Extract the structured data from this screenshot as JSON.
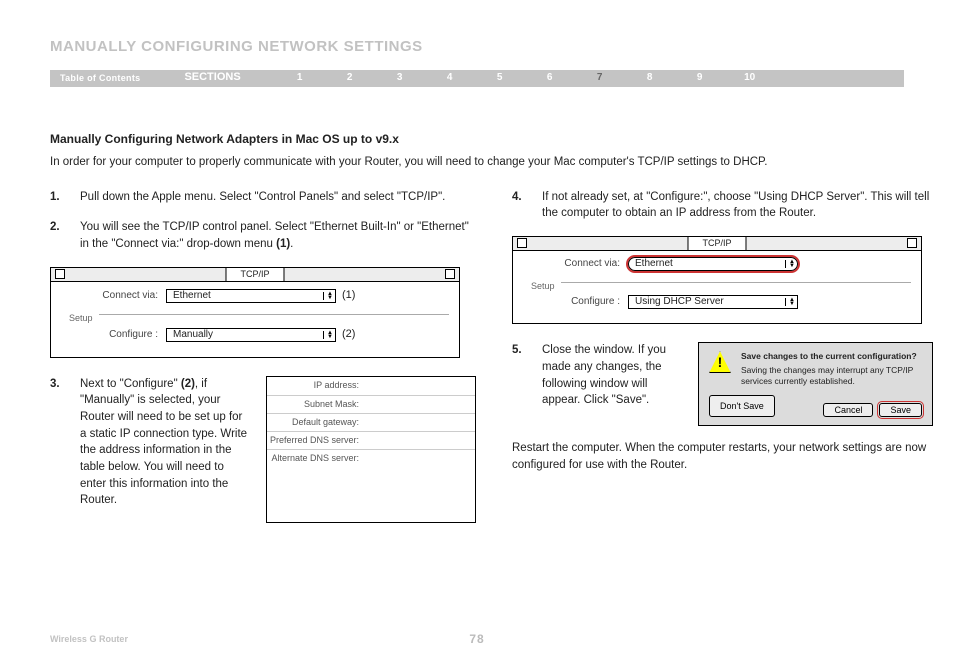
{
  "page_title": "MANUALLY CONFIGURING NETWORK SETTINGS",
  "nav": {
    "toc": "Table of Contents",
    "sections_label": "SECTIONS",
    "numbers": [
      "1",
      "2",
      "3",
      "4",
      "5",
      "6",
      "7",
      "8",
      "9",
      "10"
    ],
    "active_index": 6
  },
  "subheading": "Manually Configuring Network Adapters in Mac OS up to v9.x",
  "intro": "In order for your computer to properly communicate with your Router, you will need to change your Mac computer's TCP/IP settings to DHCP.",
  "steps": {
    "s1": {
      "n": "1.",
      "text": "Pull down the Apple menu. Select \"Control Panels\" and select \"TCP/IP\"."
    },
    "s2": {
      "n": "2.",
      "text_a": "You will see the TCP/IP control panel. Select \"Ethernet Built-In\" or \"Ethernet\" in the \"Connect via:\" drop-down menu ",
      "bold": "(1)",
      "text_b": "."
    },
    "s3": {
      "n": "3.",
      "text_a": "Next to \"Configure\" ",
      "bold": "(2)",
      "text_b": ", if \"Manually\" is selected, your Router will need to be set up for a static IP connection type. Write the address information in the table below. You will need to enter this information into the Router."
    },
    "s4": {
      "n": "4.",
      "text": "If not already set, at \"Configure:\", choose \"Using DHCP Server\". This will tell the computer to obtain an IP address from the Router."
    },
    "s5": {
      "n": "5.",
      "text": "Close the window. If you made any changes, the following window will appear. Click \"Save\"."
    }
  },
  "restart_text": "Restart the computer. When the computer restarts, your network settings are now configured for use with the Router.",
  "tcpip_window": {
    "title": "TCP/IP",
    "connect_via_label": "Connect via:",
    "connect_via_value": "Ethernet",
    "setup_label": "Setup",
    "configure_label": "Configure :",
    "configure_value_manual": "Manually",
    "configure_value_dhcp": "Using DHCP Server",
    "marker1": "(1)",
    "marker2": "(2)"
  },
  "ip_table": {
    "rows": [
      {
        "k": "IP address:",
        "v": ""
      },
      {
        "k": "Subnet Mask:",
        "v": ""
      },
      {
        "k": "Default gateway:",
        "v": ""
      },
      {
        "k": "Preferred DNS server:",
        "v": ""
      },
      {
        "k": "Alternate DNS server:",
        "v": ""
      }
    ]
  },
  "save_dialog": {
    "line1": "Save changes to the current configuration?",
    "line2": "Saving the changes may interrupt any TCP/IP services currently established.",
    "btn_dont": "Don't Save",
    "btn_cancel": "Cancel",
    "btn_save": "Save"
  },
  "footer": {
    "doc": "Wireless G Router",
    "page": "78"
  }
}
